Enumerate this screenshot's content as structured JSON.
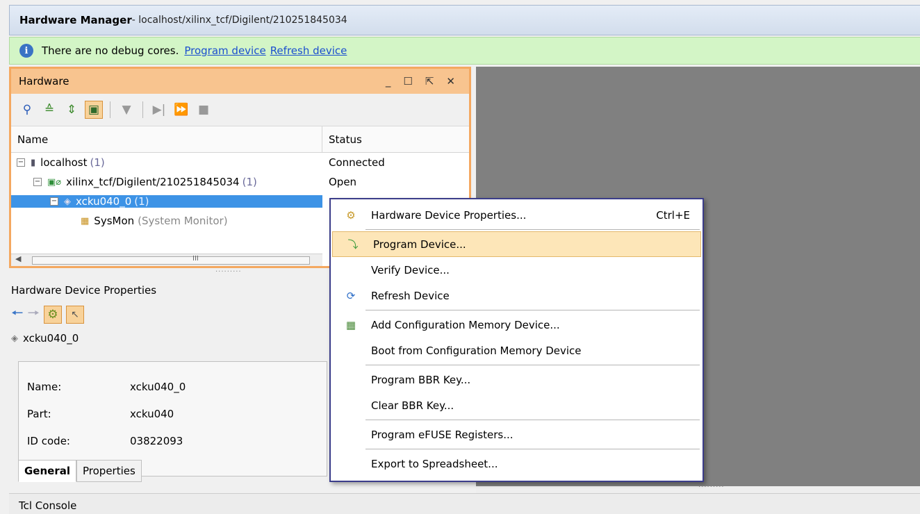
{
  "title": {
    "app": "Hardware Manager",
    "path": " - localhost/xilinx_tcf/Digilent/210251845034"
  },
  "infobar": {
    "message": "There are no debug cores.",
    "link1": "Program device",
    "link2": "Refresh device"
  },
  "hardware": {
    "title": "Hardware",
    "controls": {
      "minimize": "_",
      "maximize": "☐",
      "float": "⇱",
      "close": "✕"
    },
    "columns": {
      "name": "Name",
      "status": "Status"
    },
    "rows": [
      {
        "name": "localhost",
        "count": "(1)",
        "status": "Connected"
      },
      {
        "name": "xilinx_tcf/Digilent/210251845034",
        "count": "(1)",
        "status": "Open"
      },
      {
        "name": "xcku040_0",
        "count": "(1)",
        "status": ""
      },
      {
        "name": "SysMon",
        "extra": "(System Monitor)",
        "status": ""
      }
    ],
    "scroll_glyph": "III"
  },
  "properties": {
    "title": "Hardware Device Properties",
    "device": "xcku040_0",
    "fields": [
      {
        "key": "Name:",
        "value": "xcku040_0"
      },
      {
        "key": "Part:",
        "value": "xcku040"
      },
      {
        "key": "ID code:",
        "value": "03822093"
      }
    ],
    "tabs": {
      "general": "General",
      "properties": "Properties"
    }
  },
  "console": {
    "title": "Tcl Console"
  },
  "context_menu": {
    "items": [
      {
        "label": "Hardware Device Properties...",
        "shortcut": "Ctrl+E",
        "icon": "properties-icon"
      },
      {
        "label": "Program Device...",
        "icon": "program-icon"
      },
      {
        "label": "Verify Device..."
      },
      {
        "label": "Refresh Device",
        "icon": "refresh-icon"
      },
      {
        "label": "Add Configuration Memory Device...",
        "icon": "memory-icon"
      },
      {
        "label": "Boot from Configuration Memory Device"
      },
      {
        "label": "Program BBR Key..."
      },
      {
        "label": "Clear BBR Key..."
      },
      {
        "label": "Program eFUSE Registers..."
      },
      {
        "label": "Export to Spreadsheet..."
      }
    ]
  },
  "colors": {
    "panel_border": "#f4a860",
    "selection": "#3d93e6",
    "menu_highlight": "#fde6b8",
    "info_bg": "#d3f5c6"
  }
}
